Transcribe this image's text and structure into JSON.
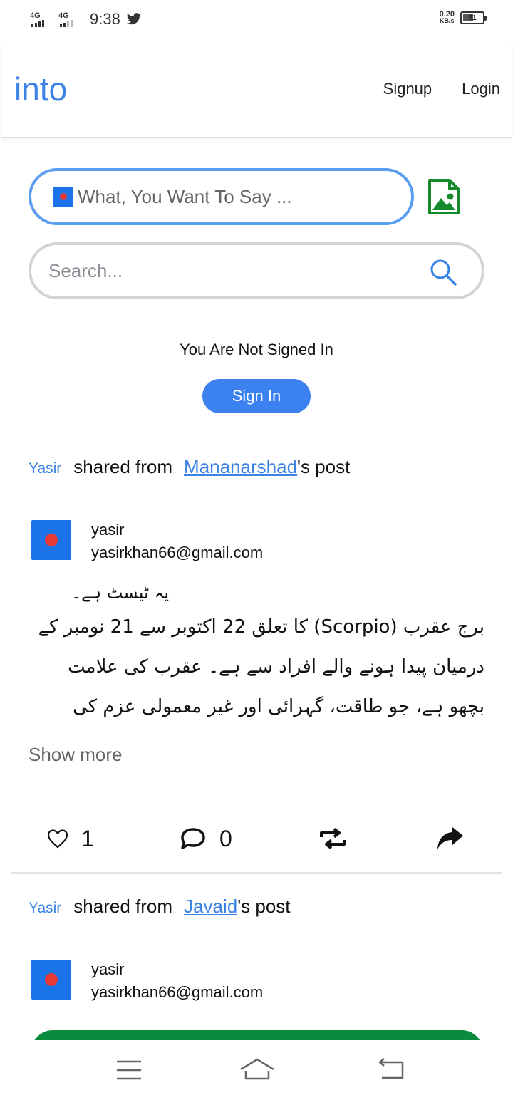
{
  "status_bar": {
    "network_1": "4G",
    "network_2": "4G",
    "time": "9:38",
    "notification_icon": "twitter-icon",
    "net_speed_value": "0.20",
    "net_speed_unit": "KB/s",
    "battery": "51"
  },
  "navbar": {
    "brand": "into",
    "signup": "Signup",
    "login": "Login"
  },
  "composer": {
    "prompt": "What, You Want To Say ...",
    "image_icon": "image-file-icon"
  },
  "search": {
    "placeholder": "Search...",
    "icon": "search-icon"
  },
  "auth": {
    "message": "You Are Not Signed In",
    "button": "Sign In"
  },
  "posts": [
    {
      "sharer": "Yasir",
      "shared_from_text": "shared from",
      "source_user": "Mananarshad ",
      "suffix": "'s post",
      "author_name": "yasir",
      "author_email": "yasirkhan66@gmail.com",
      "body_line_1": "یہ ٹیسٹ ہے۔",
      "body_line_2": "برج عقرب (Scorpio) کا تعلق 22 اکتوبر سے 21 نومبر کے درمیان پیدا ہونے والے افراد سے ہے۔ عقرب کی علامت بچھو ہے، جو طاقت، گہرائی اور غیر معمولی عزم کی",
      "show_more": "Show more",
      "likes": "1",
      "comments": "0"
    },
    {
      "sharer": "Yasir",
      "shared_from_text": "shared from",
      "source_user": "Javaid",
      "suffix": "'s post",
      "author_name": "yasir",
      "author_email": "yasirkhan66@gmail.com"
    }
  ],
  "colors": {
    "brand": "#3b82e6",
    "primary_button": "#3b82f0",
    "green": "#0a8a3c",
    "image_icon": "#148a2a"
  }
}
